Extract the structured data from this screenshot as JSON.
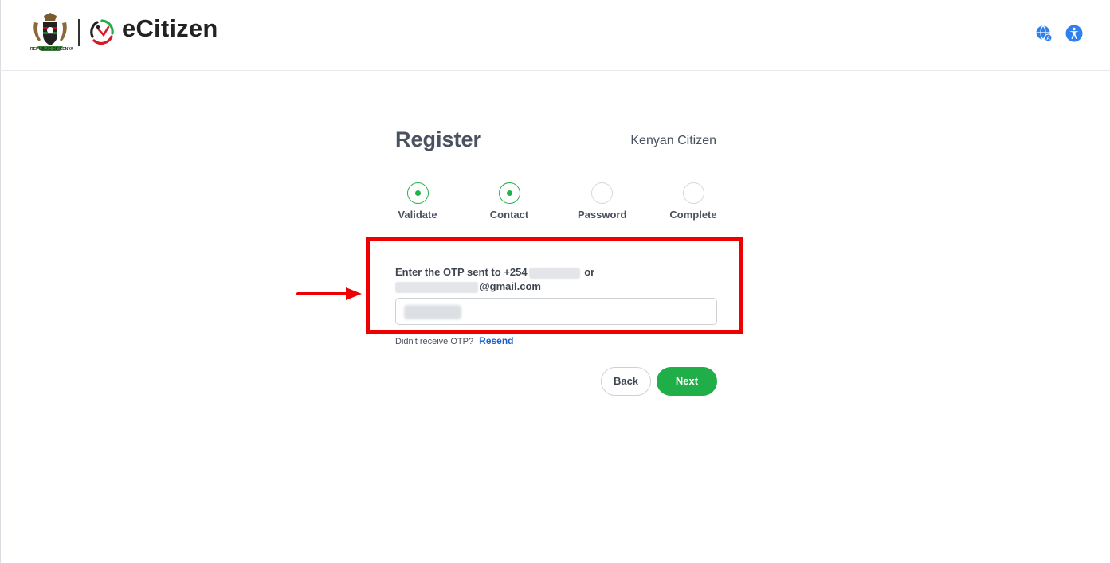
{
  "header": {
    "coat_caption": "REPUBLIC OF KENYA",
    "brand": "eCitizen",
    "icons": {
      "language": "language-icon",
      "accessibility": "accessibility-icon"
    }
  },
  "form": {
    "title": "Register",
    "subtitle": "Kenyan Citizen",
    "steps": [
      {
        "label": "Validate",
        "state": "done"
      },
      {
        "label": "Contact",
        "state": "done"
      },
      {
        "label": "Password",
        "state": "pending"
      },
      {
        "label": "Complete",
        "state": "pending"
      }
    ],
    "otp_prompt_prefix": "Enter the OTP sent to +254",
    "otp_prompt_or": "or",
    "otp_email_suffix": "@gmail.com",
    "resend_prompt": "Didn't receive OTP?",
    "resend_link": "Resend",
    "back_label": "Back",
    "next_label": "Next"
  },
  "colors": {
    "accent_green": "#1fae48",
    "link_blue": "#1a5fd0",
    "annotation_red": "#ee0000"
  }
}
